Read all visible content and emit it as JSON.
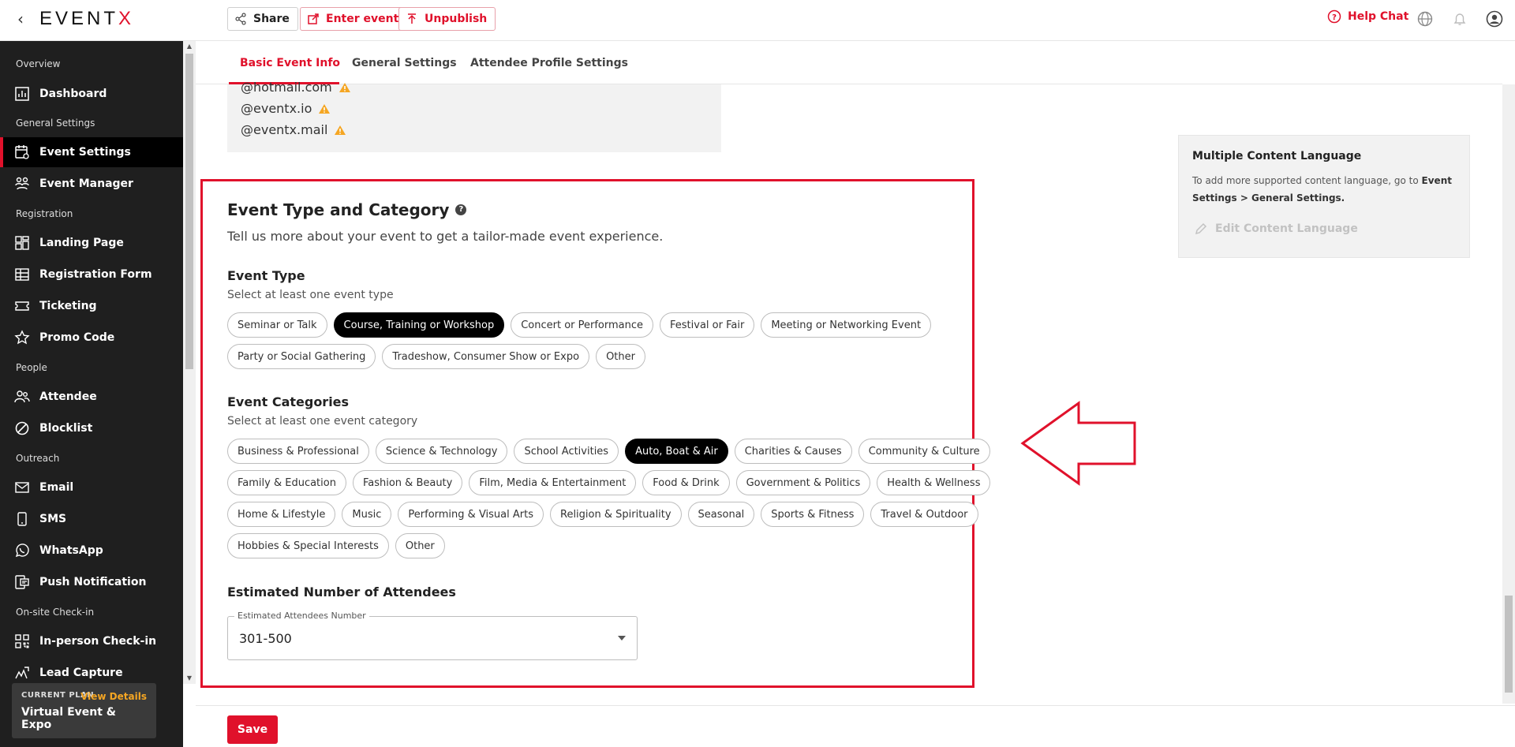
{
  "app": {
    "logo": "EVENT",
    "logo_x": "X",
    "brand_color": "#e0112b"
  },
  "topbar": {
    "share": "Share",
    "enter_event": "Enter event",
    "unpublish": "Unpublish",
    "help_chat": "Help Chat"
  },
  "sidebar": {
    "sections": {
      "overview": "Overview",
      "general": "General Settings",
      "registration": "Registration",
      "people": "People",
      "outreach": "Outreach",
      "checkin": "On-site Check-in"
    },
    "items": [
      {
        "label": "Dashboard",
        "icon": "dashboard-icon"
      },
      {
        "label": "Event Settings",
        "icon": "event-settings-icon",
        "active": true
      },
      {
        "label": "Event Manager",
        "icon": "people-icon"
      },
      {
        "label": "Landing Page",
        "icon": "layout-icon"
      },
      {
        "label": "Registration Form",
        "icon": "table-icon"
      },
      {
        "label": "Ticketing",
        "icon": "ticket-icon"
      },
      {
        "label": "Promo Code",
        "icon": "star-icon"
      },
      {
        "label": "Attendee",
        "icon": "attendee-icon"
      },
      {
        "label": "Blocklist",
        "icon": "block-icon"
      },
      {
        "label": "Email",
        "icon": "mail-icon"
      },
      {
        "label": "SMS",
        "icon": "phone-icon"
      },
      {
        "label": "WhatsApp",
        "icon": "whatsapp-icon"
      },
      {
        "label": "Push Notification",
        "icon": "push-icon"
      },
      {
        "label": "In-person Check-in",
        "icon": "qr-icon"
      },
      {
        "label": "Lead Capture",
        "icon": "scan-icon"
      }
    ],
    "plan": {
      "label": "CURRENT PLAN",
      "view_details": "View Details",
      "name": "Virtual Event & Expo"
    }
  },
  "tabs": [
    "Basic Event Info",
    "General Settings",
    "Attendee Profile Settings"
  ],
  "domains": [
    "@hotmail.com",
    "@eventx.io",
    "@eventx.mail"
  ],
  "event_type_category": {
    "title": "Event Type and Category",
    "subtitle": "Tell us more about your event to get a tailor-made event experience.",
    "event_type": {
      "heading": "Event Type",
      "hint": "Select at least one event type",
      "rows": [
        [
          {
            "label": "Seminar or Talk",
            "selected": false
          },
          {
            "label": "Course, Training or Workshop",
            "selected": true
          },
          {
            "label": "Concert or Performance",
            "selected": false
          },
          {
            "label": "Festival or Fair",
            "selected": false
          },
          {
            "label": "Meeting or Networking Event",
            "selected": false
          }
        ],
        [
          {
            "label": "Party or Social Gathering",
            "selected": false
          },
          {
            "label": "Tradeshow, Consumer Show or Expo",
            "selected": false
          },
          {
            "label": "Other",
            "selected": false
          }
        ]
      ]
    },
    "event_categories": {
      "heading": "Event Categories",
      "hint": "Select at least one event category",
      "rows": [
        [
          {
            "label": "Business & Professional",
            "selected": false
          },
          {
            "label": "Science & Technology",
            "selected": false
          },
          {
            "label": "School Activities",
            "selected": false
          },
          {
            "label": "Auto, Boat & Air",
            "selected": true
          },
          {
            "label": "Charities & Causes",
            "selected": false
          },
          {
            "label": "Community & Culture",
            "selected": false
          }
        ],
        [
          {
            "label": "Family & Education",
            "selected": false
          },
          {
            "label": "Fashion & Beauty",
            "selected": false
          },
          {
            "label": "Film, Media & Entertainment",
            "selected": false
          },
          {
            "label": "Food & Drink",
            "selected": false
          },
          {
            "label": "Government & Politics",
            "selected": false
          },
          {
            "label": "Health & Wellness",
            "selected": false
          }
        ],
        [
          {
            "label": "Home & Lifestyle",
            "selected": false
          },
          {
            "label": "Music",
            "selected": false
          },
          {
            "label": "Performing & Visual Arts",
            "selected": false
          },
          {
            "label": "Religion & Spirituality",
            "selected": false
          },
          {
            "label": "Seasonal",
            "selected": false
          },
          {
            "label": "Sports & Fitness",
            "selected": false
          },
          {
            "label": "Travel & Outdoor",
            "selected": false
          }
        ],
        [
          {
            "label": "Hobbies & Special Interests",
            "selected": false
          },
          {
            "label": "Other",
            "selected": false
          }
        ]
      ]
    },
    "attendees": {
      "heading": "Estimated Number of Attendees",
      "field_label": "Estimated Attendees Number",
      "value": "301-500"
    }
  },
  "content_language": {
    "title": "Multiple Content Language",
    "desc_prefix": "To add more supported content language, go to ",
    "desc_bold": "Event Settings > General Settings.",
    "edit": "Edit Content Language"
  },
  "footer": {
    "save": "Save"
  }
}
